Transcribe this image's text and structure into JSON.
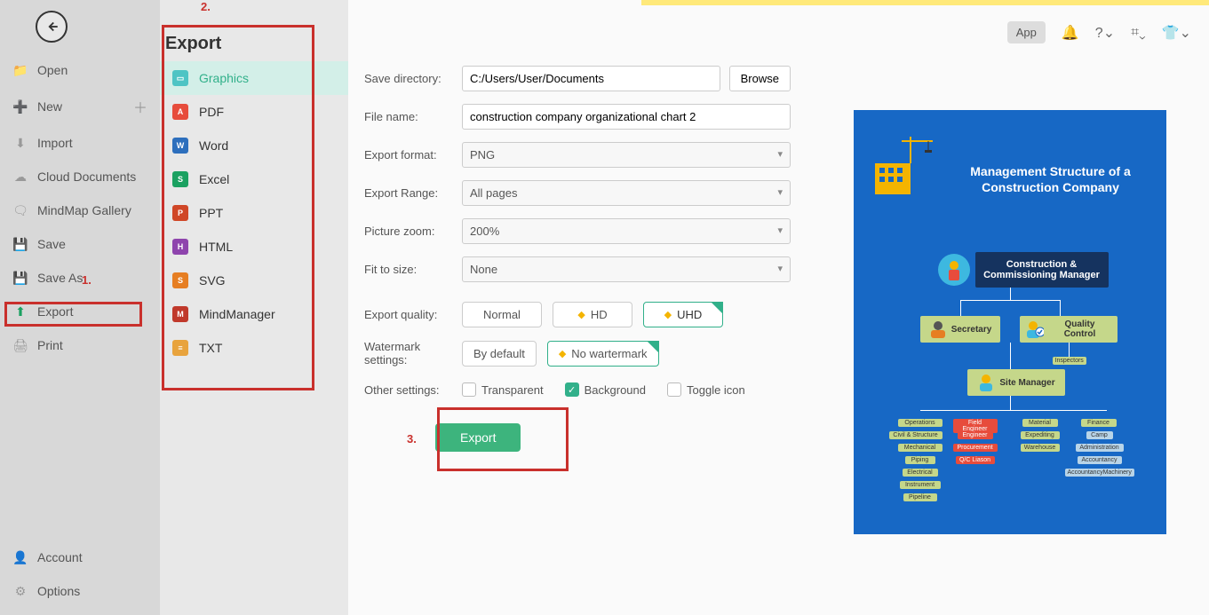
{
  "nav": {
    "open": "Open",
    "new": "New",
    "import": "Import",
    "cloud": "Cloud Documents",
    "gallery": "MindMap Gallery",
    "save": "Save",
    "saveas": "Save As",
    "export": "Export",
    "print": "Print",
    "account": "Account",
    "options": "Options"
  },
  "annot": {
    "one": "1.",
    "two": "2.",
    "three": "3."
  },
  "exportPanel": {
    "title": "Export",
    "graphics": "Graphics",
    "pdf": "PDF",
    "word": "Word",
    "excel": "Excel",
    "ppt": "PPT",
    "html": "HTML",
    "svg": "SVG",
    "mindmanager": "MindManager",
    "txt": "TXT"
  },
  "form": {
    "savedir_label": "Save directory:",
    "savedir": "C:/Users/User/Documents",
    "browse": "Browse",
    "filename_label": "File name:",
    "filename": "construction company organizational chart 2",
    "format_label": "Export format:",
    "format": "PNG",
    "range_label": "Export Range:",
    "range": "All pages",
    "zoom_label": "Picture zoom:",
    "zoom": "200%",
    "fit_label": "Fit to size:",
    "fit": "None",
    "quality_label": "Export quality:",
    "quality_normal": "Normal",
    "quality_hd": "HD",
    "quality_uhd": "UHD",
    "wm_label": "Watermark settings:",
    "wm_default": "By default",
    "wm_none": "No wartermark",
    "other_label": "Other settings:",
    "transparent": "Transparent",
    "background": "Background",
    "toggle_icon": "Toggle icon",
    "export_btn": "Export"
  },
  "topbar": {
    "app": "App"
  },
  "preview": {
    "title_line1": "Management Structure of a",
    "title_line2": "Construction Company",
    "ccm": "Construction & Commissioning Manager",
    "secretary": "Secretary",
    "qc": "Quality Control",
    "inspectors": "Inspectors",
    "sitemgr": "Site Manager",
    "cols": {
      "operations": "Operations",
      "fieldeng": "Field Engineer",
      "material": "Material",
      "finance": "Finance"
    },
    "ops": [
      "Civil & Structure",
      "Mechanical",
      "Piping",
      "Electrical",
      "Instrument",
      "Pipeline"
    ],
    "feng": [
      "Engineer",
      "Procurement",
      "Q/C Liason"
    ],
    "mat": [
      "Expediting",
      "Warehouse"
    ],
    "fin": [
      "Camp",
      "Administration",
      "Accountancy",
      "AccountancyMachinery"
    ]
  }
}
